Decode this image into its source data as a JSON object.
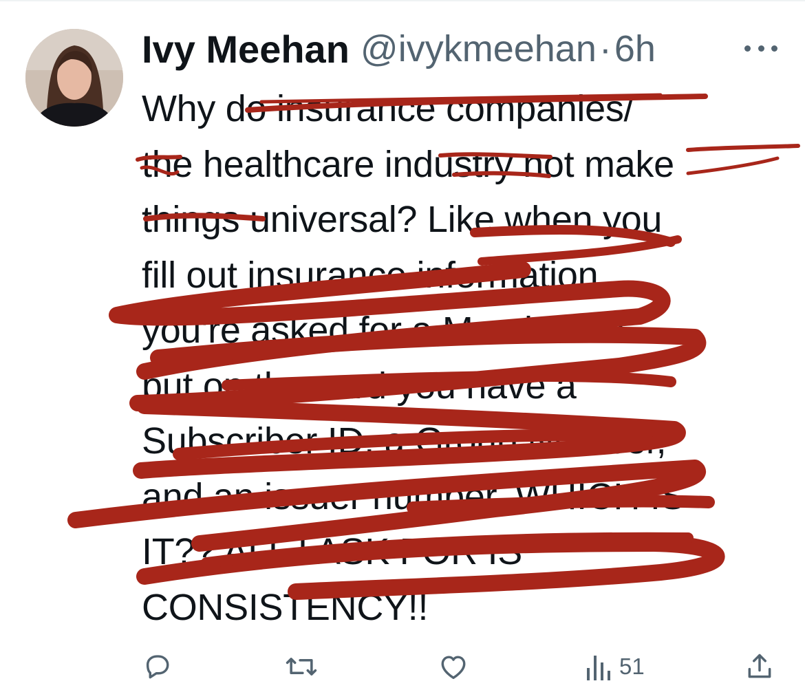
{
  "tweet": {
    "author_name": "Ivy Meehan",
    "handle": "@ivykmeehan",
    "separator": "·",
    "time": "6h",
    "lines": [
      "Why do insurance companies/",
      "the healthcare industry not make",
      "things universal? Like when you",
      "fill out insurance information",
      "you're asked for a Member ID",
      "but on the card you have a",
      "Subscriber ID, a Group Number,",
      "and an issuer number. WHICH IS",
      "IT?? ALL I ASK FOR IS",
      "CONSISTENCY!!"
    ]
  },
  "actions": {
    "views_count": "51"
  },
  "icons": {
    "more": "more-horizontal-icon",
    "reply": "reply-icon",
    "retweet": "retweet-icon",
    "like": "heart-icon",
    "views": "views-chart-icon",
    "share": "share-icon"
  },
  "colors": {
    "scribble": "#a8261a",
    "secondary_text": "#536471",
    "primary_text": "#0f1419"
  }
}
